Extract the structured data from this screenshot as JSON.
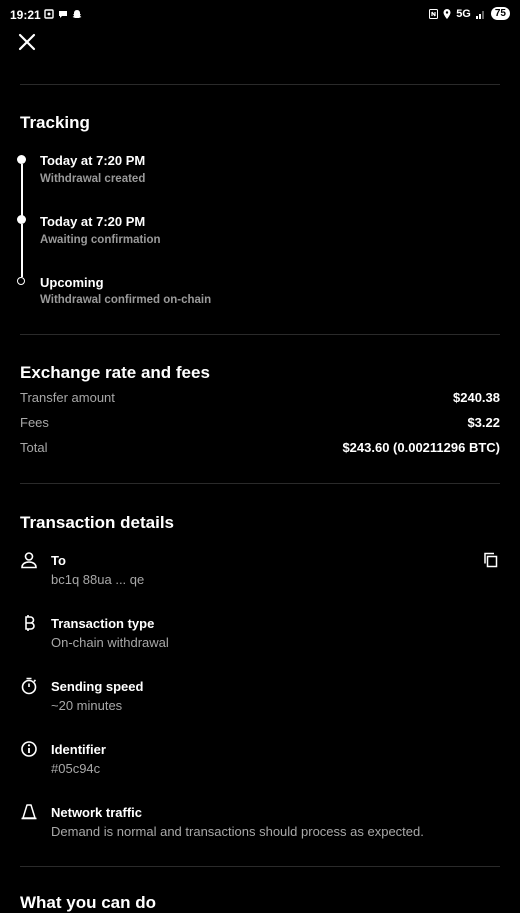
{
  "status_bar": {
    "time": "19:21",
    "network": "5G",
    "battery": "75"
  },
  "tracking": {
    "title": "Tracking",
    "steps": [
      {
        "title": "Today at 7:20 PM",
        "subtitle": "Withdrawal created"
      },
      {
        "title": "Today at 7:20 PM",
        "subtitle": "Awaiting confirmation"
      },
      {
        "title": "Upcoming",
        "subtitle": "Withdrawal confirmed on-chain"
      }
    ]
  },
  "exchange": {
    "title": "Exchange rate and fees",
    "rows": [
      {
        "label": "Transfer amount",
        "value": "$240.38"
      },
      {
        "label": "Fees",
        "value": "$3.22"
      },
      {
        "label": "Total",
        "value": "$243.60 (0.00211296 BTC)"
      }
    ]
  },
  "details": {
    "title": "Transaction details",
    "items": [
      {
        "icon": "person-icon",
        "title": "To",
        "subtitle": "bc1q 88ua ... qe"
      },
      {
        "icon": "bitcoin-icon",
        "title": "Transaction type",
        "subtitle": "On-chain withdrawal"
      },
      {
        "icon": "stopwatch-icon",
        "title": "Sending speed",
        "subtitle": "~20 minutes"
      },
      {
        "icon": "info-icon",
        "title": "Identifier",
        "subtitle": "#05c94c"
      },
      {
        "icon": "traffic-cone-icon",
        "title": "Network traffic",
        "subtitle": "Demand is normal and transactions should process as expected."
      }
    ]
  },
  "next_section": {
    "title": "What you can do"
  }
}
